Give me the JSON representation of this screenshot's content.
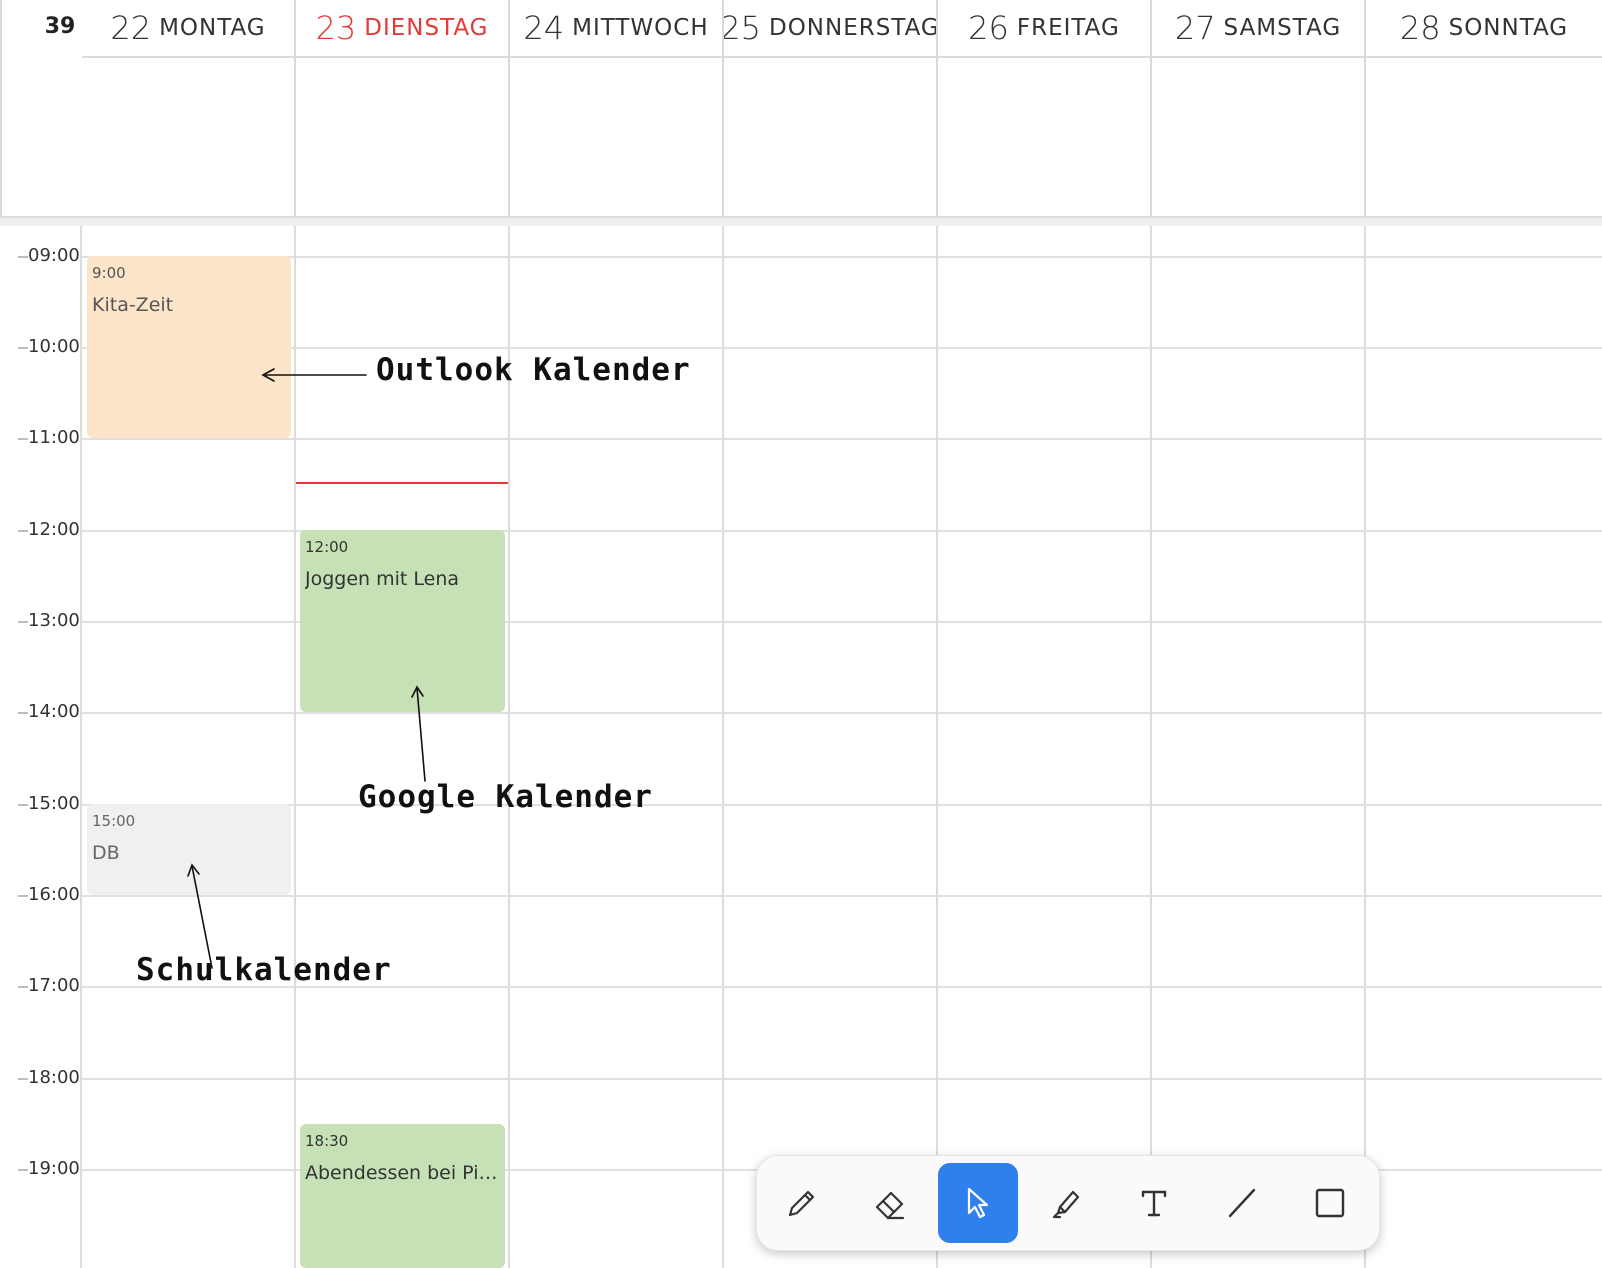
{
  "header": {
    "week_number": "39",
    "today_color": "#e53935",
    "days": [
      {
        "num": "22",
        "name": "MONTAG"
      },
      {
        "num": "23",
        "name": "DIENSTAG"
      },
      {
        "num": "24",
        "name": "MITTWOCH"
      },
      {
        "num": "25",
        "name": "DONNERSTAG"
      },
      {
        "num": "26",
        "name": "FREITAG"
      },
      {
        "num": "27",
        "name": "SAMSTAG"
      },
      {
        "num": "28",
        "name": "SONNTAG"
      }
    ]
  },
  "time_labels": [
    "09:00",
    "10:00",
    "11:00",
    "12:00",
    "13:00",
    "14:00",
    "15:00",
    "16:00",
    "17:00",
    "18:00",
    "19:00"
  ],
  "events": {
    "kita": {
      "time": "9:00",
      "title": "Kita-Zeit",
      "color": "#fce5c8",
      "text_color": "#555"
    },
    "jogging": {
      "time": "12:00",
      "title": "Joggen mit Lena",
      "color": "#c5e1b5",
      "text_color": "#333"
    },
    "db": {
      "time": "15:00",
      "title": "DB",
      "color": "#f0f0f0",
      "text_color": "#666"
    },
    "dinner": {
      "time": "18:30",
      "title": "Abendessen bei Pizzeria",
      "color": "#c5e1b5",
      "text_color": "#333"
    }
  },
  "annotations": {
    "outlook": "Outlook Kalender",
    "google": "Google Kalender",
    "schule": "Schulkalender"
  },
  "toolbar": {
    "tools": [
      "pencil-icon",
      "eraser-icon",
      "pointer-icon",
      "highlighter-icon",
      "text-icon",
      "line-icon",
      "rectangle-icon"
    ],
    "active": "pointer-icon",
    "accent": "#2f80ed"
  }
}
